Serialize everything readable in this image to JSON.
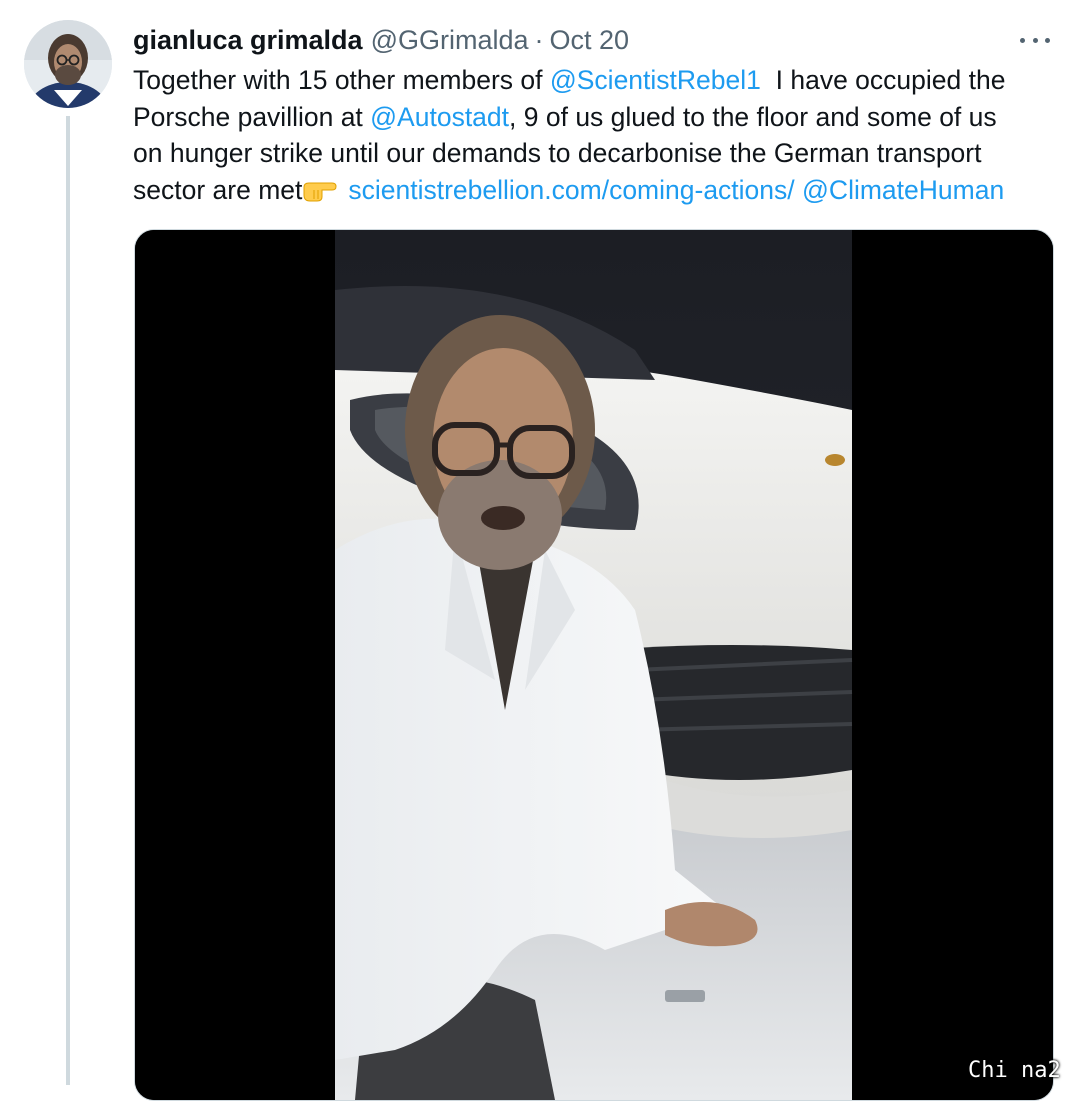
{
  "tweet": {
    "author_name": "gianluca grimalda",
    "handle": "@GGrimalda",
    "separator": "·",
    "date": "Oct 20",
    "avatar_icon": "profile-photo",
    "more_icon": "more-horizontal-icon",
    "text": {
      "l1_a": "Together with 15 other members of ",
      "l1_link": "@ScientistRebel1",
      "l1_b": "  I have occupied the",
      "l2_a": "Porsche pavillion at ",
      "l2_link": "@Autostadt",
      "l2_b": ", 9 of us glued to the floor and some of us",
      "l3": "on hunger strike until our demands to decarbonise the German transport",
      "l4_a": "sector are met",
      "l4_emoji": "backhand-index-pointing-right",
      "l4_link1": "scientistrebellion.com/coming-actions/",
      "l4_link2": "@ClimateHuman"
    },
    "media": {
      "type": "video-still",
      "description_icon": "video-thumbnail"
    },
    "watermark": "Chi na2"
  },
  "colors": {
    "link": "#1d9bf0",
    "secondary_text": "#536471",
    "thread_line": "#cfd9de"
  }
}
